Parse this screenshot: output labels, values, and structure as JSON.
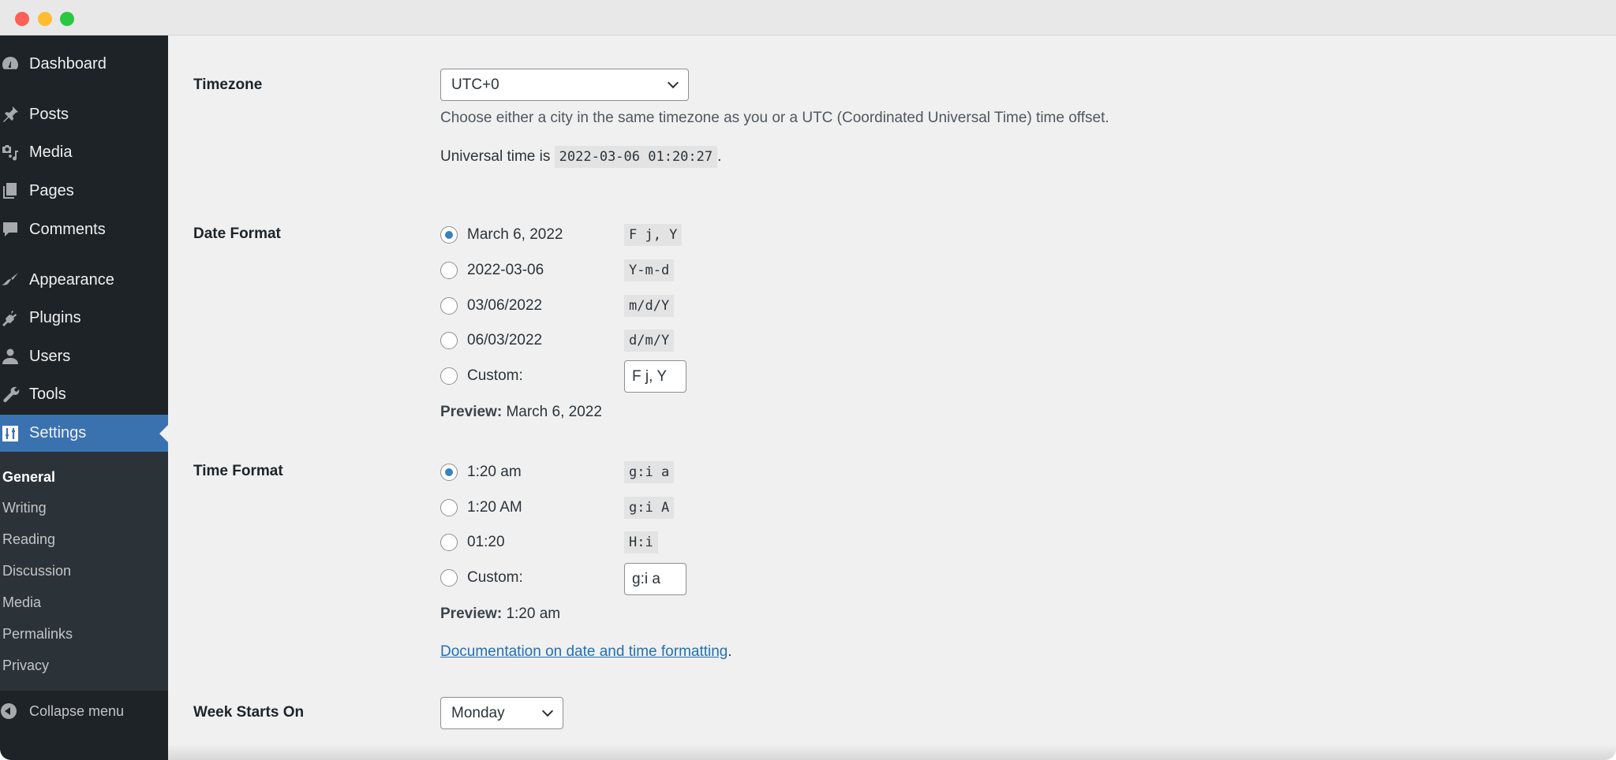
{
  "window": {
    "traffic_lights": [
      "close",
      "minimize",
      "zoom"
    ]
  },
  "sidebar": {
    "items": [
      {
        "label": "Dashboard",
        "icon": "dashboard-icon"
      },
      {
        "label": "Posts",
        "icon": "pin-icon"
      },
      {
        "label": "Media",
        "icon": "media-icon"
      },
      {
        "label": "Pages",
        "icon": "pages-icon"
      },
      {
        "label": "Comments",
        "icon": "comment-icon"
      },
      {
        "label": "Appearance",
        "icon": "paintbrush-icon"
      },
      {
        "label": "Plugins",
        "icon": "plugin-icon"
      },
      {
        "label": "Users",
        "icon": "user-icon"
      },
      {
        "label": "Tools",
        "icon": "wrench-icon"
      },
      {
        "label": "Settings",
        "icon": "settings-sliders-icon",
        "current": true
      }
    ],
    "submenu": [
      {
        "label": "General",
        "current": true
      },
      {
        "label": "Writing"
      },
      {
        "label": "Reading"
      },
      {
        "label": "Discussion"
      },
      {
        "label": "Media"
      },
      {
        "label": "Permalinks"
      },
      {
        "label": "Privacy"
      }
    ],
    "collapse_label": "Collapse menu",
    "accent_color": "#3a72b0"
  },
  "main": {
    "timezone": {
      "label": "Timezone",
      "selected": "UTC+0",
      "description": "Choose either a city in the same timezone as you or a UTC (Coordinated Universal Time) time offset.",
      "universal_prefix": "Universal time is",
      "universal_value": "2022-03-06 01:20:27",
      "universal_suffix": "."
    },
    "date_format": {
      "label": "Date Format",
      "options": [
        {
          "label": "March 6, 2022",
          "code": "F j, Y",
          "checked": true
        },
        {
          "label": "2022-03-06",
          "code": "Y-m-d",
          "checked": false
        },
        {
          "label": "03/06/2022",
          "code": "m/d/Y",
          "checked": false
        },
        {
          "label": "06/03/2022",
          "code": "d/m/Y",
          "checked": false
        }
      ],
      "custom_label": "Custom:",
      "custom_value": "F j, Y",
      "preview_label": "Preview:",
      "preview_value": "March 6, 2022"
    },
    "time_format": {
      "label": "Time Format",
      "options": [
        {
          "label": "1:20 am",
          "code": "g:i a",
          "checked": true
        },
        {
          "label": "1:20 AM",
          "code": "g:i A",
          "checked": false
        },
        {
          "label": "01:20",
          "code": "H:i",
          "checked": false
        }
      ],
      "custom_label": "Custom:",
      "custom_value": "g:i a",
      "preview_label": "Preview:",
      "preview_value": "1:20 am",
      "doc_link": "Documentation on date and time formatting",
      "doc_suffix": "."
    },
    "week_starts": {
      "label": "Week Starts On",
      "selected": "Monday"
    }
  }
}
